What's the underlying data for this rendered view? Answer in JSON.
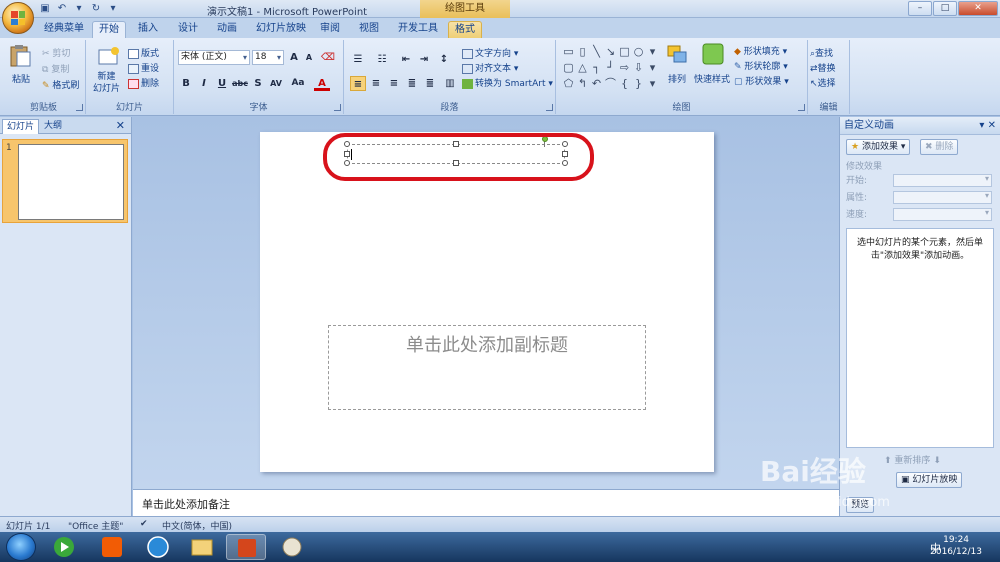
{
  "window": {
    "title": "演示文稿1 - Microsoft PowerPoint",
    "context_tool": "绘图工具",
    "buttons": [
      "–",
      "□",
      "✕"
    ]
  },
  "tabs": [
    "经典菜单",
    "开始",
    "插入",
    "设计",
    "动画",
    "幻灯片放映",
    "审阅",
    "视图",
    "开发工具",
    "格式"
  ],
  "ribbon": {
    "clipboard": {
      "label": "剪贴板",
      "paste": "粘贴",
      "cut": "剪切",
      "copy": "复制",
      "format_painter": "格式刷"
    },
    "slides": {
      "label": "幻灯片",
      "new_slide": "新建\n幻灯片",
      "layout": "版式",
      "reset": "重设",
      "delete": "删除"
    },
    "font": {
      "label": "字体",
      "font_name": "宋体 (正文)",
      "font_size": "18",
      "bold": "B",
      "italic": "I",
      "underline": "U",
      "strike": "abc",
      "shadow": "S",
      "spacing": "AV",
      "case": "Aa",
      "color": "A",
      "grow": "A",
      "shrink": "A"
    },
    "paragraph": {
      "label": "段落",
      "text_direction": "文字方向",
      "align_text": "对齐文本",
      "smartart": "转换为 SmartArt"
    },
    "drawing": {
      "label": "绘图",
      "arrange": "排列",
      "quick_styles": "快速样式",
      "shape_fill": "形状填充",
      "shape_outline": "形状轮廓",
      "shape_effects": "形状效果"
    },
    "editing": {
      "label": "编辑",
      "find": "查找",
      "replace": "替换",
      "select": "选择"
    }
  },
  "left_pane": {
    "tab_slides": "幻灯片",
    "tab_outline": "大纲",
    "slide_number": "1"
  },
  "slide": {
    "subtitle_placeholder": "单击此处添加副标题"
  },
  "notes": {
    "placeholder": "单击此处添加备注"
  },
  "right_pane": {
    "title": "自定义动画",
    "add_effect": "添加效果",
    "remove": "删除",
    "modify_effect": "修改效果",
    "start": "开始:",
    "property": "属性:",
    "speed": "速度:",
    "hint": "选中幻灯片的某个元素，然后单击\"添加效果\"添加动画。",
    "reorder": "重新排序",
    "slideshow": "幻灯片放映",
    "preview": "预览"
  },
  "status_bar": {
    "slide_count": "幻灯片 1/1",
    "theme": "\"Office 主题\"",
    "language": "中文(简体，中国)"
  },
  "taskbar": {
    "time": "19:24",
    "date": "2016/12/13",
    "tray_ime": "中"
  },
  "watermark": {
    "brand": "Bai经验",
    "url": "jingyan.baidu.com"
  },
  "colors": {
    "highlight": "#d8121b",
    "ribbon_bg": "#d3e1f3",
    "format_tab": "#eecf76"
  }
}
